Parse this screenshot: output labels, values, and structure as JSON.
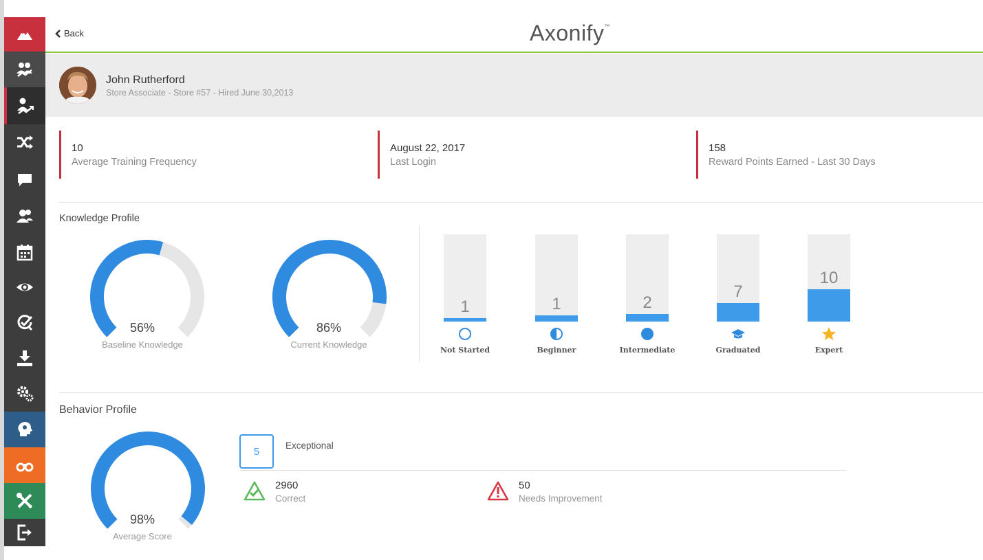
{
  "header": {
    "back_label": "Back",
    "logo_text": "Axonify",
    "logo_tm": "™"
  },
  "sidebar": {
    "items": [
      {
        "icon": "mountain-icon",
        "color": "#c8303e"
      },
      {
        "icon": "team-icon",
        "color": "#4a4a4a"
      },
      {
        "icon": "person-trend-icon",
        "color": "#3d3d3d"
      },
      {
        "icon": "shuffle-icon",
        "color": "#3d3d3d"
      },
      {
        "icon": "chat-icon",
        "color": "#3d3d3d"
      },
      {
        "icon": "people-icon",
        "color": "#3d3d3d"
      },
      {
        "icon": "calendar-icon",
        "color": "#3d3d3d"
      },
      {
        "icon": "eye-icon",
        "color": "#3d3d3d"
      },
      {
        "icon": "target-check-icon",
        "color": "#3d3d3d"
      },
      {
        "icon": "download-icon",
        "color": "#3d3d3d"
      },
      {
        "icon": "gears-icon",
        "color": "#3d3d3d"
      },
      {
        "icon": "head-gear-icon",
        "color": "#2f5d8a"
      },
      {
        "icon": "binoculars-icon",
        "color": "#ef6c24"
      },
      {
        "icon": "tools-icon",
        "color": "#2e8b57"
      },
      {
        "icon": "logout-icon",
        "color": "#3d3d3d"
      }
    ]
  },
  "profile": {
    "name": "John Rutherford",
    "subtitle": "Store Associate - Store #57 - Hired June 30,2013"
  },
  "stats": [
    {
      "value": "10",
      "label": "Average Training Frequency"
    },
    {
      "value": "August 22, 2017",
      "label": "Last Login"
    },
    {
      "value": "158",
      "label": "Reward Points Earned - Last 30 Days"
    }
  ],
  "knowledge": {
    "title": "Knowledge Profile",
    "gauges": [
      {
        "value_text": "56%",
        "fraction": 0.56,
        "label": "Baseline Knowledge"
      },
      {
        "value_text": "86%",
        "fraction": 0.86,
        "label": "Current Knowledge"
      }
    ],
    "levels": [
      {
        "count": "1",
        "fill_fraction": 0.04,
        "label": "Not Started",
        "icon": "circle-outline-icon"
      },
      {
        "count": "1",
        "fill_fraction": 0.07,
        "label": "Beginner",
        "icon": "half-circle-icon"
      },
      {
        "count": "2",
        "fill_fraction": 0.09,
        "label": "Intermediate",
        "icon": "filled-circle-icon"
      },
      {
        "count": "7",
        "fill_fraction": 0.21,
        "label": "Graduated",
        "icon": "graduation-cap-icon"
      },
      {
        "count": "10",
        "fill_fraction": 0.37,
        "label": "Expert",
        "icon": "star-icon"
      }
    ]
  },
  "behavior": {
    "title": "Behavior Profile",
    "gauge": {
      "value_text": "98%",
      "fraction": 0.98,
      "label": "Average Score"
    },
    "score": "5",
    "score_label": "Exceptional",
    "correct_value": "2960",
    "correct_label": "Correct",
    "needs_value": "50",
    "needs_label": "Needs Improvement"
  },
  "colors": {
    "accent_red": "#c8303e",
    "blue": "#2f8be0",
    "bar_blue": "#3d9be9",
    "green": "#8cc63f",
    "track": "#e6e6e6"
  }
}
